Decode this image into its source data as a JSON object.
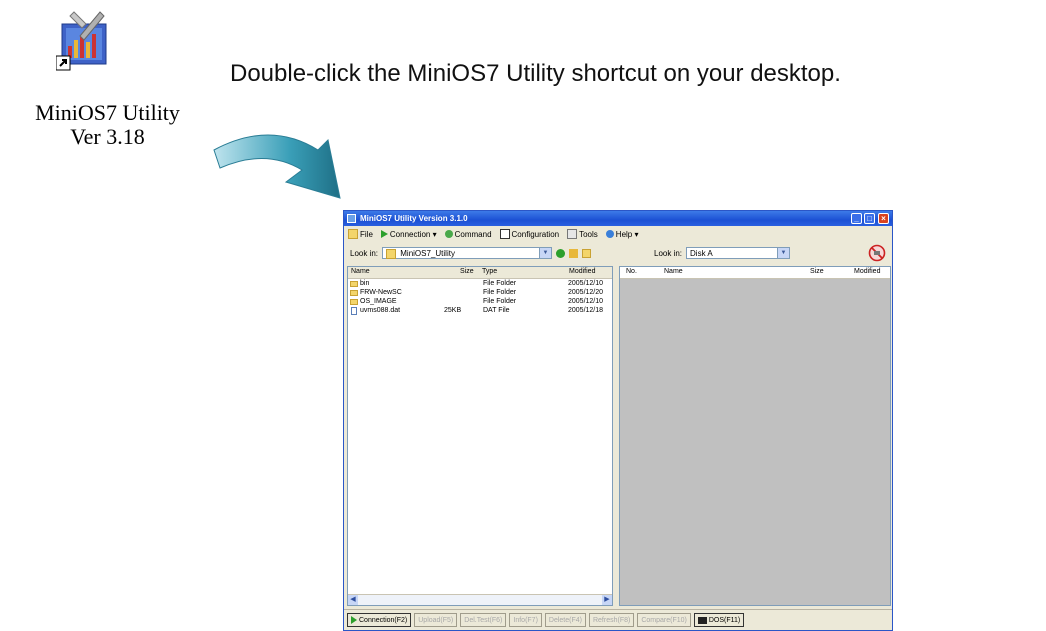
{
  "desktop_icon": {
    "line1": "MiniOS7 Utility",
    "line2": "Ver 3.18",
    "icon": "minios7-utility-shortcut-icon"
  },
  "instruction": "Double-click the MiniOS7 Utility shortcut on your desktop.",
  "window": {
    "title": "MiniOS7 Utility Version 3.1.0",
    "menu": [
      {
        "label": "File",
        "icon": "folder-icon"
      },
      {
        "label": "Connection ▾",
        "icon": "play-icon"
      },
      {
        "label": "Command",
        "icon": "command-icon"
      },
      {
        "label": "Configuration",
        "icon": "config-icon"
      },
      {
        "label": "Tools",
        "icon": "tools-icon"
      },
      {
        "label": "Help ▾",
        "icon": "help-icon"
      }
    ],
    "left_look_in_label": "Look in:",
    "left_look_in_value": "MiniOS7_Utility",
    "right_look_in_label": "Look in:",
    "right_look_in_value": "Disk A",
    "left_columns": [
      "Name",
      "Size",
      "Type",
      "Modified"
    ],
    "files": [
      {
        "name": "bin",
        "size": "",
        "type": "File Folder",
        "modified": "2005/12/10",
        "kind": "folder"
      },
      {
        "name": "FRW-NewSC",
        "size": "",
        "type": "File Folder",
        "modified": "2005/12/20",
        "kind": "folder"
      },
      {
        "name": "OS_IMAGE",
        "size": "",
        "type": "File Folder",
        "modified": "2005/12/10",
        "kind": "folder"
      },
      {
        "name": "uvms088.dat",
        "size": "25KB",
        "type": "DAT File",
        "modified": "2005/12/18",
        "kind": "file"
      }
    ],
    "right_columns": [
      "No.",
      "Name",
      "Size",
      "Modified"
    ],
    "function_buttons": [
      {
        "label": "Connection(F2)",
        "enabled": true
      },
      {
        "label": "Upload(F5)",
        "enabled": false
      },
      {
        "label": "Del.Test(F6)",
        "enabled": false
      },
      {
        "label": "Info(F7)",
        "enabled": false
      },
      {
        "label": "Delete(F4)",
        "enabled": false
      },
      {
        "label": "Refresh(F8)",
        "enabled": false
      },
      {
        "label": "Compare(F10)",
        "enabled": false
      },
      {
        "label": "DOS(F11)",
        "enabled": true
      }
    ]
  }
}
